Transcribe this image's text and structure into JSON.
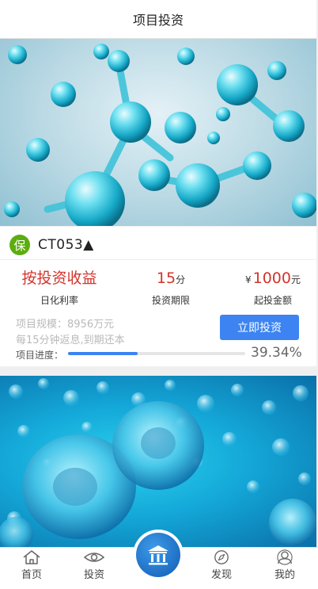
{
  "header": {
    "title": "项目投资"
  },
  "product": {
    "badge": "保",
    "name": "CT053▲",
    "yield_type": "按投资收益",
    "yield_caption": "日化利率",
    "term_value": "15",
    "term_unit": "分",
    "term_caption": "投资期限",
    "min_currency": "¥",
    "min_value": "1000",
    "min_unit": "元",
    "min_caption": "起投金额",
    "scale_text": "项目规模：8956万元",
    "repay_text": "每15分钟返息,到期还本",
    "invest_button": "立即投资",
    "progress_label": "项目进度：",
    "progress_percent": 39.34,
    "progress_text": "39.34%"
  },
  "tabbar": {
    "home": "首页",
    "invest": "投资",
    "discover": "发现",
    "mine": "我的"
  },
  "icons": {
    "badge": "shield-badge",
    "home": "home-icon",
    "invest": "eye-icon",
    "center": "bank-building-icon",
    "discover": "compass-icon",
    "mine": "user-icon"
  },
  "colors": {
    "accent_blue": "#3d84f2",
    "value_red": "#d4342b",
    "badge_green": "#5cad0e",
    "center_blue": "#1e6fc4"
  }
}
